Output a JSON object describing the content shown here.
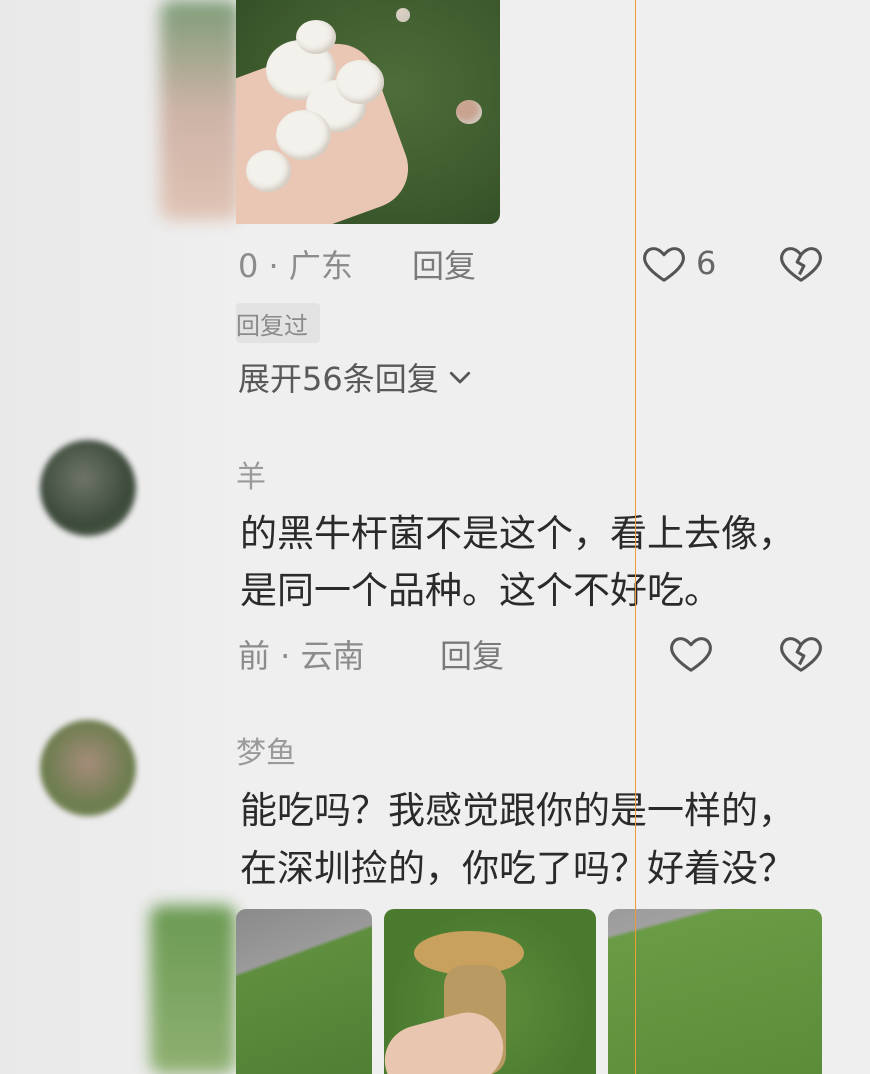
{
  "comment1": {
    "meta_location": "0 · 广东",
    "reply_label": "回复",
    "like_count": "6",
    "badge": "回复过",
    "expand_label": "展开56条回复"
  },
  "comment2": {
    "username": "羊",
    "line1": "的黑牛杆菌不是这个，看上去像，",
    "line2": "是同一个品种。这个不好吃。",
    "meta_location": "前 · 云南",
    "reply_label": "回复"
  },
  "comment3": {
    "username": "梦鱼",
    "line1": "能吃吗？我感觉跟你的是一样的，",
    "line2": "在深圳捡的，你吃了吗？好着没？"
  },
  "colors": {
    "background": "#efefef",
    "guide_line": "#f19a3a"
  }
}
